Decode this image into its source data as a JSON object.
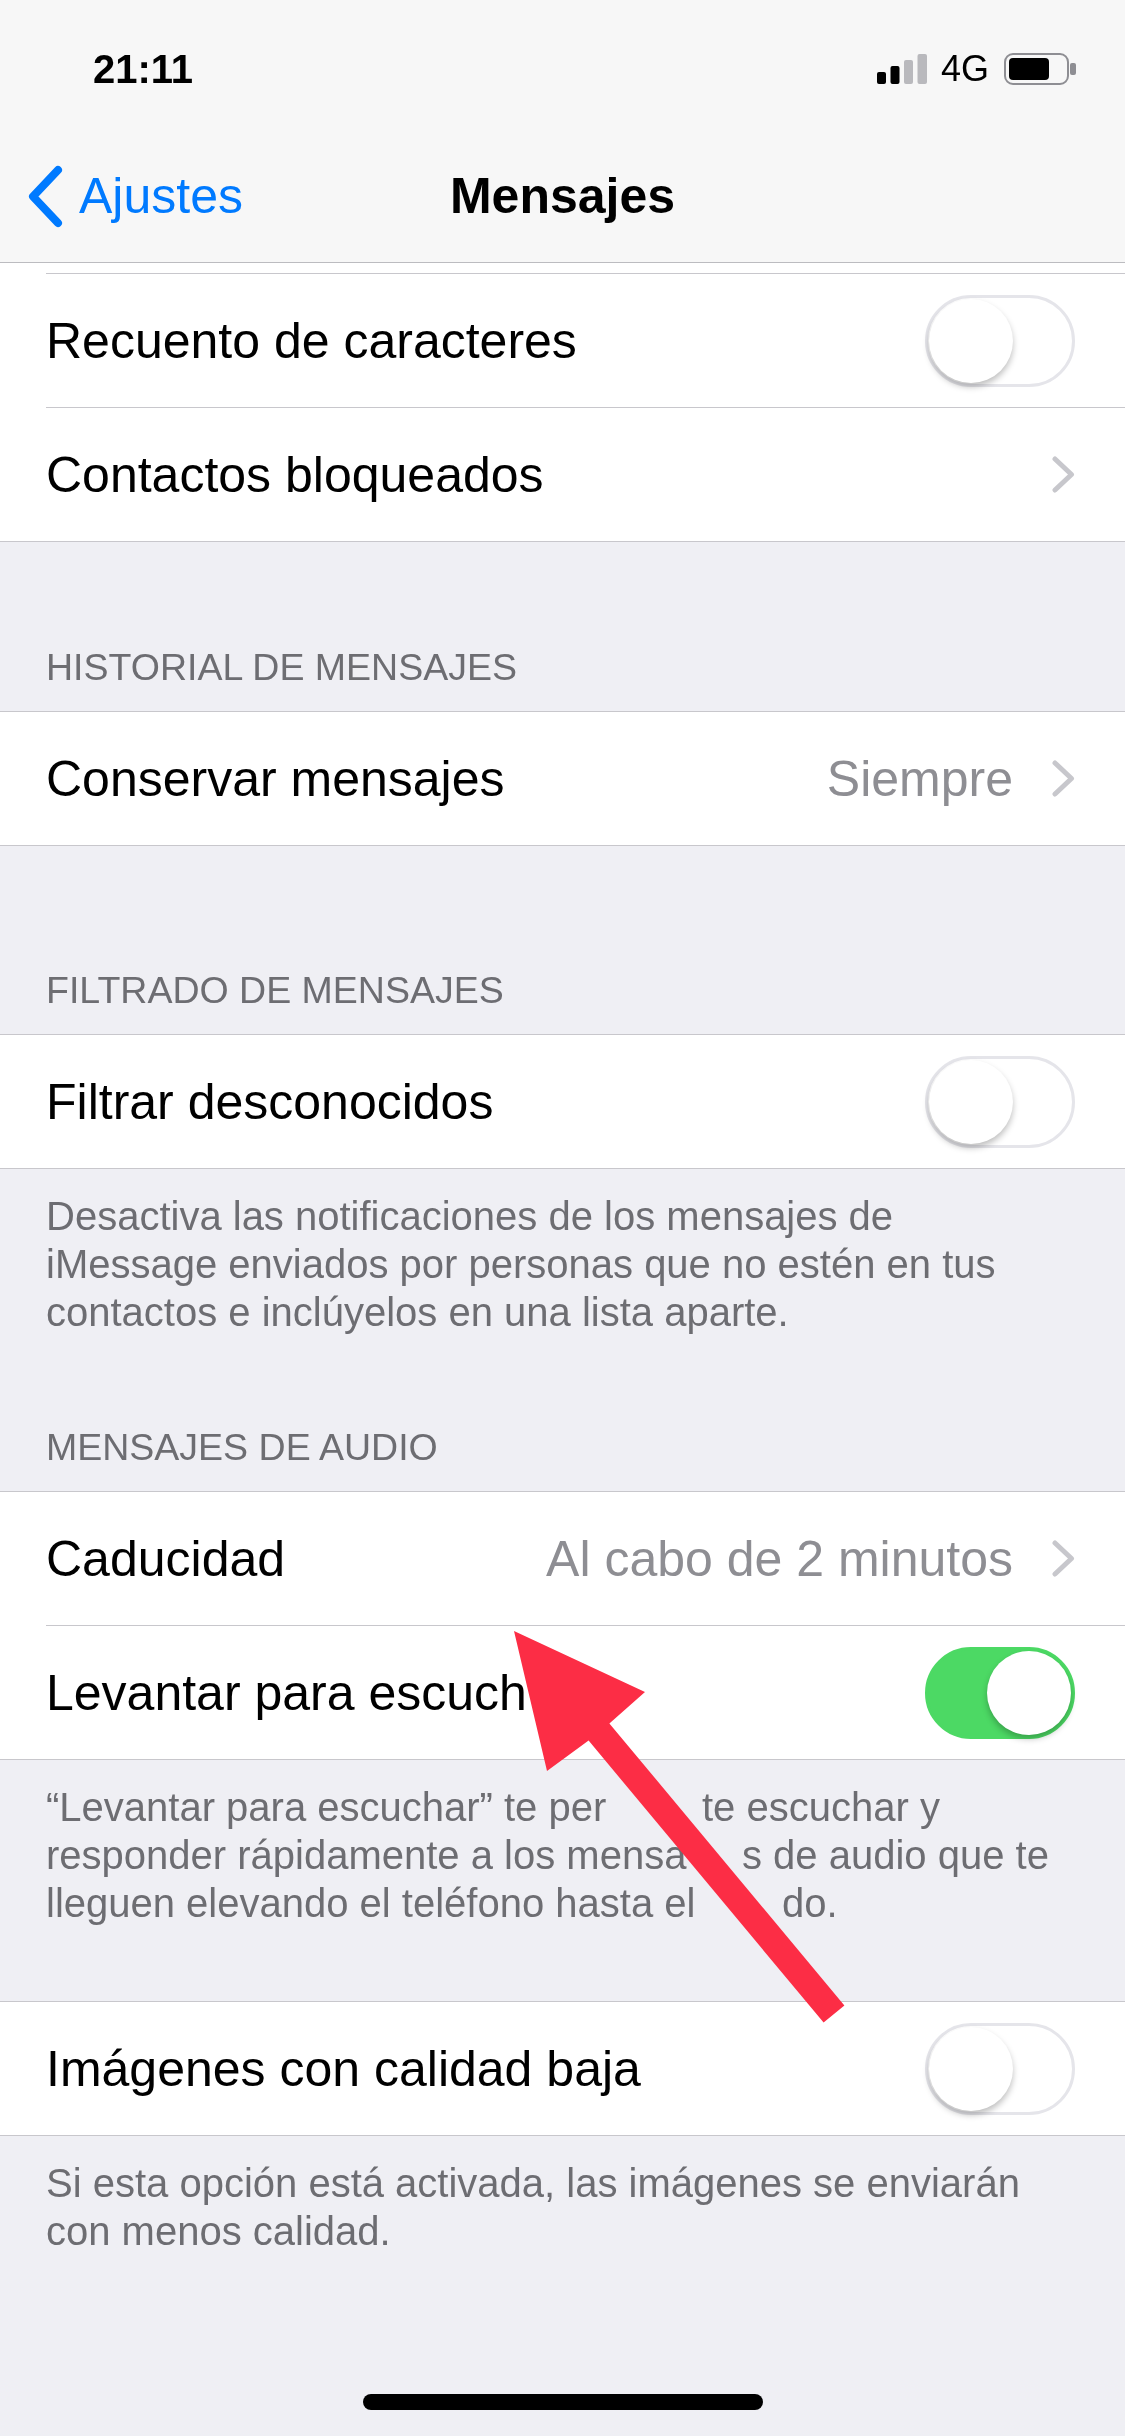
{
  "status_bar": {
    "time": "21:11",
    "network": "4G"
  },
  "nav_bar": {
    "back_label": "Ajustes",
    "title": "Mensajes"
  },
  "sections": [
    {
      "rows": [
        {
          "kind": "toggle",
          "label": "Recuento de caracteres",
          "on": false
        },
        {
          "kind": "link",
          "label": "Contactos bloqueados"
        }
      ]
    },
    {
      "header": "HISTORIAL DE MENSAJES",
      "rows": [
        {
          "kind": "link",
          "label": "Conservar mensajes",
          "value": "Siempre"
        }
      ]
    },
    {
      "header": "FILTRADO DE MENSAJES",
      "rows": [
        {
          "kind": "toggle",
          "label": "Filtrar desconocidos",
          "on": false
        }
      ],
      "footer": "Desactiva las notificaciones de los mensajes de iMessage enviados por personas que no estén en tus contactos e inclúyelos en una lista aparte."
    },
    {
      "header": "MENSAJES DE AUDIO",
      "rows": [
        {
          "kind": "link",
          "label": "Caducidad",
          "value": "Al cabo de 2 minutos"
        },
        {
          "kind": "toggle",
          "label": "Levantar para escuch",
          "on": true
        }
      ],
      "footer_lines": [
        [
          "“Levantar para escuchar” te per",
          "te escuchar y"
        ],
        [
          "responder rápidamente a los mensa",
          "s de audio que te"
        ],
        [
          "lleguen elevando el teléfono hasta el",
          "do."
        ]
      ]
    },
    {
      "rows": [
        {
          "kind": "toggle",
          "label": "Imágenes con calidad baja",
          "on": false
        }
      ],
      "footer": "Si esta opción está activada, las imágenes se enviarán con menos calidad."
    }
  ],
  "annotations": [
    {
      "kind": "arrow"
    }
  ]
}
